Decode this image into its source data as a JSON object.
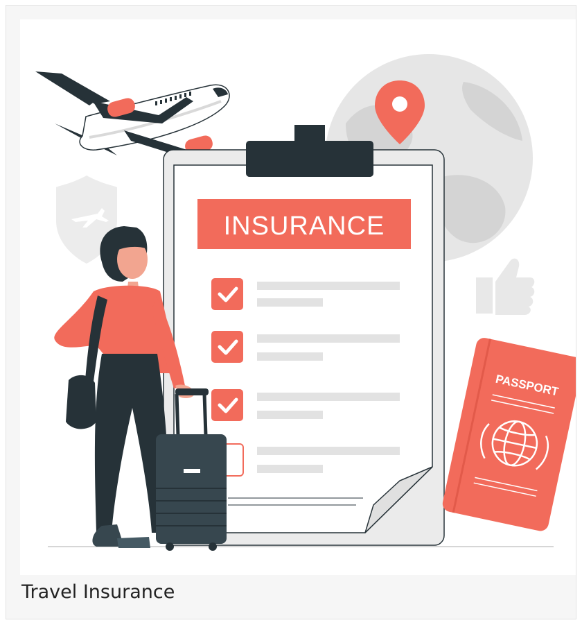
{
  "card": {
    "caption": "Travel Insurance",
    "illustration": {
      "clipboard_title": "INSURANCE",
      "passport_label": "PASSPORT",
      "checklist": [
        {
          "checked": true
        },
        {
          "checked": true
        },
        {
          "checked": true
        },
        {
          "checked": false
        }
      ]
    }
  },
  "colors": {
    "accent": "#f26b5b",
    "dark": "#263238",
    "light_gray": "#ebebeb",
    "mid_gray": "#e0e0e0",
    "caption_text": "#222222",
    "card_bg": "#f6f6f6"
  },
  "icons": [
    "airplane-icon",
    "globe-icon",
    "location-pin-icon",
    "shield-plane-icon",
    "thumbs-up-icon",
    "passport-icon",
    "globe-laurel-icon",
    "checkmark-icon",
    "suitcase-icon"
  ]
}
